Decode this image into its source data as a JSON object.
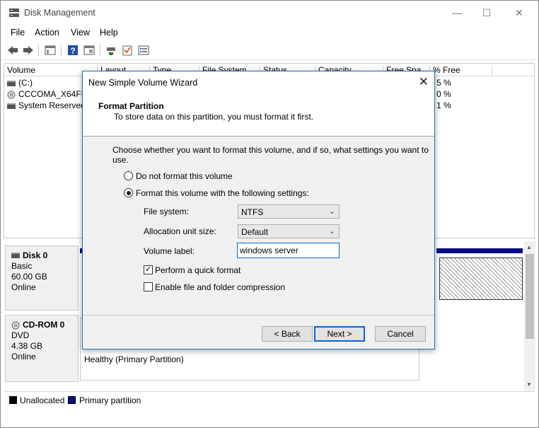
{
  "app": {
    "title": "Disk Management",
    "minimize": "—",
    "maximize": "☐",
    "close": "✕"
  },
  "menu": [
    "File",
    "Action",
    "View",
    "Help"
  ],
  "toolbar": {
    "icons": [
      "back-icon",
      "forward-icon",
      "console-tree-icon",
      "help-icon",
      "properties-icon",
      "connect-icon",
      "check-icon",
      "list-icon"
    ]
  },
  "volume_list": {
    "columns": [
      "Volume",
      "Layout",
      "Type",
      "File System",
      "Status",
      "Capacity",
      "Free Spa...",
      "% Free"
    ],
    "rows": [
      {
        "volume": "(C:)",
        "pct_free": "5 %"
      },
      {
        "volume": "CCCOMA_X64FR",
        "pct_free": "0 %"
      },
      {
        "volume": "System Reserved",
        "pct_free": "1 %"
      }
    ]
  },
  "disks": [
    {
      "name": "Disk 0",
      "type": "Basic",
      "size": "60.00 GB",
      "status": "Online"
    },
    {
      "name": "CD-ROM 0",
      "type": "DVD",
      "size": "4.38 GB",
      "status": "Online"
    }
  ],
  "cd_partition": {
    "status": "Healthy (Primary Partition)"
  },
  "legend": [
    {
      "label": "Unallocated",
      "color": "#000000"
    },
    {
      "label": "Primary partition",
      "color": "#0b0b86"
    }
  ],
  "wizard": {
    "title": "New Simple Volume Wizard",
    "close": "✕",
    "header_title": "Format Partition",
    "header_subtitle": "To store data on this partition, you must format it first.",
    "instruction": "Choose whether you want to format this volume, and if so, what settings you want to use.",
    "option_no_format": "Do not format this volume",
    "option_format": "Format this volume with the following settings:",
    "selected_option": "format",
    "file_system_label": "File system:",
    "file_system_value": "NTFS",
    "allocation_label": "Allocation unit size:",
    "allocation_value": "Default",
    "volume_label_label": "Volume label:",
    "volume_label_value": "windows server",
    "quick_format_label": "Perform a quick format",
    "quick_format_checked": true,
    "compression_label": "Enable file and folder compression",
    "compression_checked": false,
    "back_label": "< Back",
    "next_label": "Next >",
    "cancel_label": "Cancel"
  },
  "colors": {
    "accent": "#0a67c9",
    "partition_bar": "#0b0b86"
  }
}
